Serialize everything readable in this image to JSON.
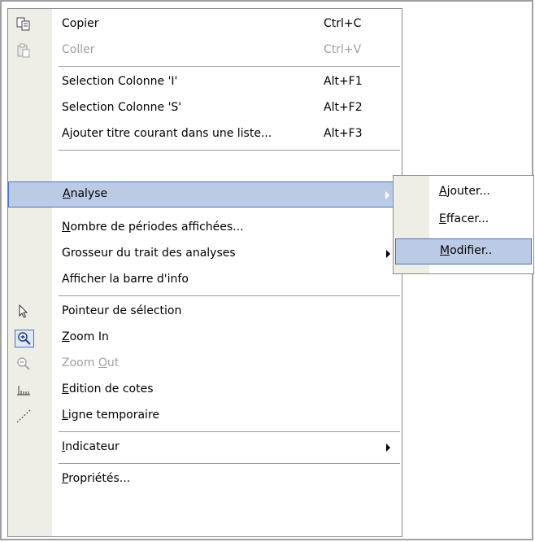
{
  "menu": {
    "items": [
      {
        "label": "Copier",
        "shortcut": "Ctrl+C",
        "icon": "copy-icon"
      },
      {
        "label": "Coller",
        "shortcut": "Ctrl+V",
        "icon": "paste-icon",
        "disabled": true
      },
      {
        "label": "Selection Colonne 'I'",
        "shortcut": "Alt+F1"
      },
      {
        "label": "Selection Colonne 'S'",
        "shortcut": "Alt+F2"
      },
      {
        "label": "Ajouter titre courant dans une liste...",
        "shortcut": "Alt+F3"
      },
      {
        "label_u": "A",
        "label_rest": "nalyse",
        "submenu": true,
        "highlighted": true
      },
      {
        "label_u": "N",
        "label_rest": "ombre de périodes affichées..."
      },
      {
        "label": "Grosseur du trait des analyses",
        "submenu": true
      },
      {
        "label": "Afficher la barre d'info"
      },
      {
        "label": "Pointeur de sélection",
        "icon": "pointer-icon"
      },
      {
        "label_u": "Z",
        "label_rest": "oom In",
        "icon": "zoom-in-icon",
        "checked": true
      },
      {
        "label_pre": "Zoom ",
        "label_u": "O",
        "label_rest": "ut",
        "icon": "zoom-out-icon",
        "disabled": true
      },
      {
        "label_u": "E",
        "label_rest": "dition de cotes",
        "icon": "ruler-icon"
      },
      {
        "label_u": "L",
        "label_rest": "igne temporaire",
        "icon": "dotted-line-icon"
      },
      {
        "label_u": "I",
        "label_rest": "ndicateur",
        "submenu": true
      },
      {
        "label_u": "P",
        "label_rest": "ropriétés..."
      }
    ]
  },
  "submenu": {
    "items": [
      {
        "label_u": "A",
        "label_rest": "jouter..."
      },
      {
        "label_u": "E",
        "label_rest": "ffacer..."
      },
      {
        "label_u": "M",
        "label_rest": "odifier..",
        "highlighted": true
      }
    ]
  },
  "colors": {
    "highlight": "#bccbe5",
    "highlight_border": "#4a72c0",
    "gutter": "#efeee6"
  }
}
